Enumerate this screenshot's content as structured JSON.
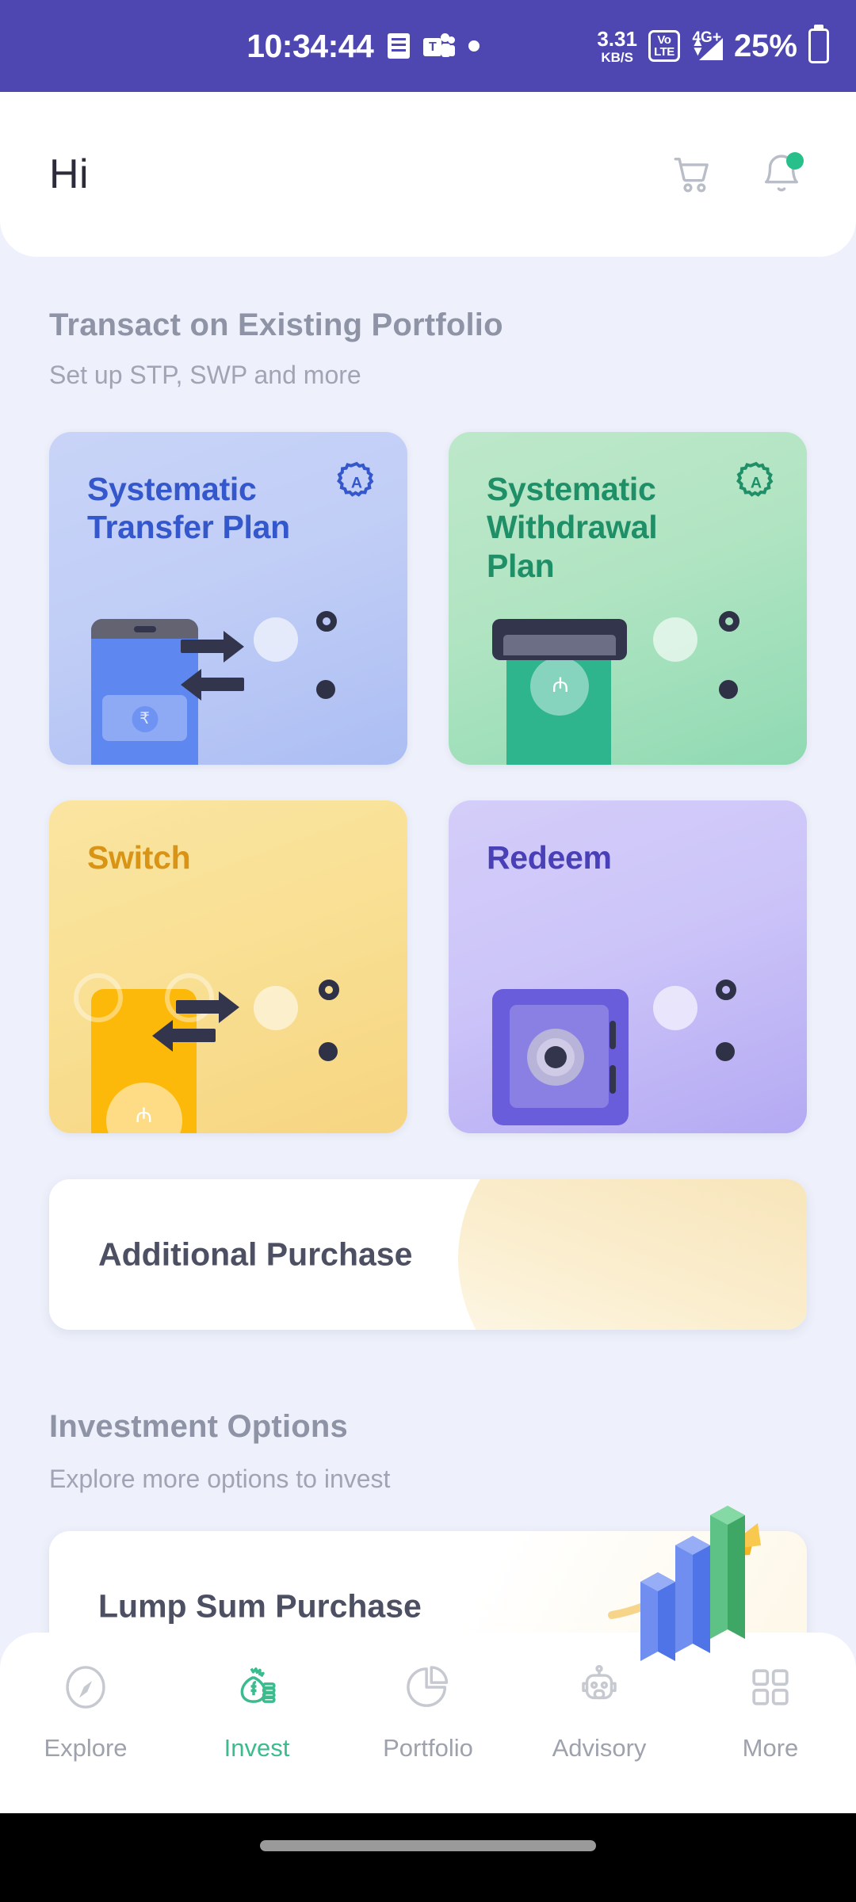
{
  "statusbar": {
    "clock": "10:34:44",
    "icons": [
      "message-icon",
      "teams-icon",
      "dot-icon"
    ],
    "data_speed_value": "3.31",
    "data_speed_unit": "KB/S",
    "volte_top": "Vo",
    "volte_bottom": "LTE",
    "network": "4G+",
    "battery_percent": "25%",
    "bg_color": "#4e47b2"
  },
  "header": {
    "greeting": "Hi",
    "cart_icon": "cart-icon",
    "bell_icon": "bell-icon",
    "notification_dot_color": "#27c08a"
  },
  "sections": [
    {
      "title": "Transact on Existing Portfolio",
      "subtitle": "Set up STP, SWP and more"
    },
    {
      "title": "Investment Options",
      "subtitle": "Explore more options to invest"
    }
  ],
  "transact_cards": [
    {
      "title": "Systematic Transfer Plan",
      "title_color": "#3457cb",
      "bg_from": "#e4eafd",
      "bg_to": "#b8c8f6",
      "wave_color": "rgba(150,172,238,0.55)",
      "badge": "auto-gear-a-icon",
      "badge_color": "#3457cb",
      "illustration": "phone-transfer-icon"
    },
    {
      "title": "Systematic Withdrawal Plan",
      "title_color": "#1f8f68",
      "bg_from": "#d9f2dd",
      "bg_to": "#8fdca6",
      "wave_color": "rgba(139,213,166,0.55)",
      "badge": "auto-gear-a-icon",
      "badge_color": "#1f8f68",
      "illustration": "atm-cash-icon"
    },
    {
      "title": "Switch",
      "title_color": "#d99415",
      "bg_from": "#fae8a8",
      "bg_to": "#f5d municipal",
      "wave_color": "rgba(247,215,125,0.55)",
      "badge": "",
      "badge_color": "",
      "illustration": "banknote-switch-icon"
    },
    {
      "title": "Redeem",
      "title_color": "#4940b8",
      "bg_from": "#e0dcfb",
      "bg_to": "#b0a6f3",
      "wave_color": "rgba(176,166,243,0.5)",
      "badge": "",
      "badge_color": "",
      "illustration": "safe-vault-icon"
    }
  ],
  "additional_purchase": {
    "title": "Additional Purchase",
    "accent": "#f3dba6"
  },
  "lump_sum": {
    "title": "Lump Sum Purchase",
    "illustration": "growth-bar-chart-icon",
    "accent": "#fdf6e0"
  },
  "bottomnav": {
    "active_color": "#3cbb8e",
    "items": [
      {
        "label": "Explore",
        "icon": "compass-icon",
        "active": false
      },
      {
        "label": "Invest",
        "icon": "money-bag-icon",
        "active": true
      },
      {
        "label": "Portfolio",
        "icon": "pie-chart-icon",
        "active": false
      },
      {
        "label": "Advisory",
        "icon": "robot-icon",
        "active": false
      },
      {
        "label": "More",
        "icon": "grid-icon",
        "active": false
      }
    ]
  }
}
